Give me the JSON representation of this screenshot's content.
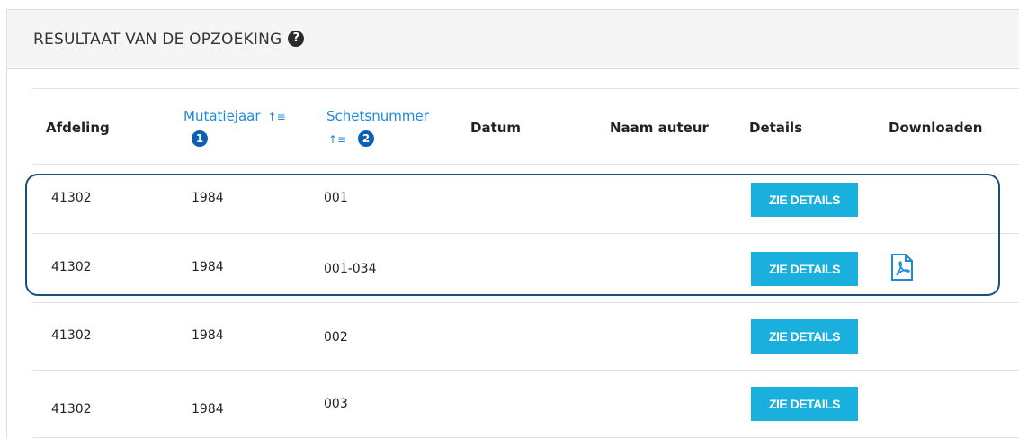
{
  "panel": {
    "title": "RESULTAAT VAN DE OPZOEKING",
    "help_icon": "question-circle-icon",
    "help_glyph": "?"
  },
  "table": {
    "headers": {
      "afdeling": "Afdeling",
      "mutatiejaar": "Mutatiejaar",
      "mutatiejaar_badge": "1",
      "schetsnummer": "Schetsnummer",
      "schetsnummer_badge": "2",
      "datum": "Datum",
      "naam_auteur": "Naam auteur",
      "details": "Details",
      "downloaden": "Downloaden"
    },
    "sort_icon": "sort-amount-asc-icon",
    "rows": [
      {
        "afdeling": "41302",
        "mutatiejaar": "1984",
        "schetsnummer": "001",
        "datum": "",
        "naam_auteur": "",
        "details_label": "ZIE DETAILS",
        "download": false
      },
      {
        "afdeling": "41302",
        "mutatiejaar": "1984",
        "schetsnummer": "001-034",
        "datum": "",
        "naam_auteur": "",
        "details_label": "ZIE DETAILS",
        "download": true
      },
      {
        "afdeling": "41302",
        "mutatiejaar": "1984",
        "schetsnummer": "002",
        "datum": "",
        "naam_auteur": "",
        "details_label": "ZIE DETAILS",
        "download": false
      },
      {
        "afdeling": "41302",
        "mutatiejaar": "1984",
        "schetsnummer": "003",
        "datum": "",
        "naam_auteur": "",
        "details_label": "ZIE DETAILS",
        "download": false
      }
    ]
  },
  "colors": {
    "accent_blue": "#1f8ad9",
    "button_cyan": "#1ab0dd",
    "badge_blue": "#0d5fb3",
    "highlight_border": "#1b4f7a"
  }
}
